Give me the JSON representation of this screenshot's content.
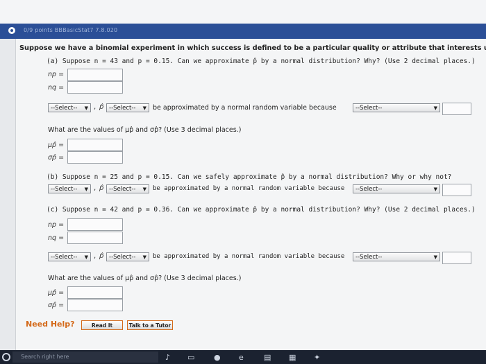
{
  "header": {
    "title": "0/9 points  BBBasicStat7 7.8.020"
  },
  "problem": {
    "intro": "Suppose we have a binomial experiment in which success is defined to be a particular quality or attribute that interests us.",
    "part_a": {
      "question": "(a) Suppose n = 43 and p = 0.15. Can we approximate p̂ by a normal distribution? Why? (Use 2 decimal places.)",
      "np_label": "np =",
      "nq_label": "nq =",
      "np_value": "",
      "nq_value": ""
    },
    "row_a": {
      "select1": "--Select--",
      "comma": ",",
      "p_hat": "p̂",
      "select2": "--Select--",
      "text": "be approximated by a normal random variable because",
      "select3": "--Select--"
    },
    "mean_question": "What are the values of μp̂ and σp̂? (Use 3 decimal places.)",
    "mu_label": "μp̂ =",
    "sigma_label": "σp̂ =",
    "mu_value": "",
    "sigma_value": "",
    "part_b": {
      "question": "(b) Suppose n = 25 and p = 0.15. Can we safely approximate p̂ by a normal distribution? Why or why not?"
    },
    "row_b": {
      "select1": "--Select--",
      "comma": ",",
      "p_hat": "p̂",
      "select2": "--Select--",
      "text": "be approximated by a normal random variable because",
      "select3": "--Select--"
    },
    "part_c": {
      "question": "(c) Suppose n = 42 and p = 0.36. Can we approximate p̂ by a normal distribution? Why? (Use 2 decimal places.)",
      "np_label": "np =",
      "nq_label": "nq =",
      "np_value": "",
      "nq_value": ""
    },
    "row_c": {
      "select1": "--Select--",
      "comma": ",",
      "p_hat": "p̂",
      "select2": "--Select--",
      "text": "be approximated by a normal random variable because",
      "select3": "--Select--"
    },
    "mean_question_c": "What are the values of μp̂ and σp̂? (Use 3 decimal places.)",
    "mu_label_c": "μp̂ =",
    "sigma_label_c": "σp̂ =",
    "mu_value_c": "",
    "sigma_value_c": ""
  },
  "help": {
    "label": "Need Help?",
    "read_it": "Read It",
    "talk_to_tutor": "Talk to a Tutor"
  },
  "taskbar": {
    "search_placeholder": "Search right here"
  },
  "colors": {
    "header": "#2b4f97",
    "accent": "#d46a1b",
    "value": "#1d5fb8"
  }
}
